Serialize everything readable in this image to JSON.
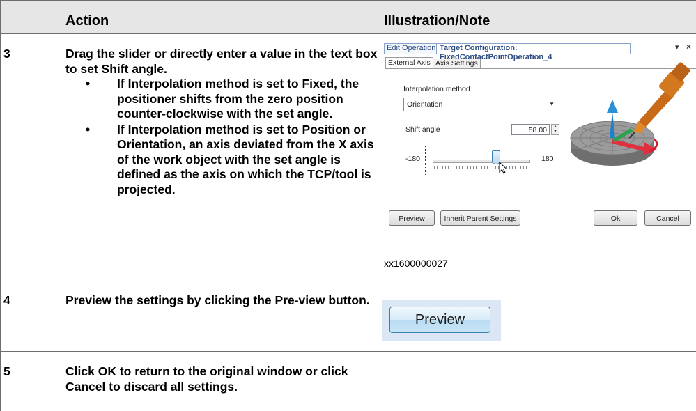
{
  "table": {
    "headers": {
      "step": "",
      "action": "Action",
      "note": "Illustration/Note"
    },
    "rows": [
      {
        "step": "3",
        "action": {
          "intro": [
            "Drag the slider or directly enter a value in the text box to set ",
            "Shift angle",
            "."
          ],
          "bullets": [
            [
              "If ",
              "Interpolation method",
              " is set to ",
              "Fixed",
              ", the positioner shifts from the zero position counter-clockwise with the set angle."
            ],
            [
              "If ",
              "Interpolation method",
              " is set to ",
              "Position",
              " or ",
              "Orientation",
              ", an axis deviated from the X axis of the work object with the set angle is defined as the axis on which the TCP/tool is projected."
            ]
          ]
        },
        "figure_caption": "xx1600000027"
      },
      {
        "step": "4",
        "action": [
          "Preview the settings by clicking the ",
          "Pre-view",
          " button."
        ]
      },
      {
        "step": "5",
        "action": [
          "Click ",
          "OK",
          " to return to the original window or click ",
          "Cancel",
          " to discard all settings."
        ]
      }
    ],
    "bullet_glyph": "•"
  },
  "dialog": {
    "tabs": [
      "Edit Operation",
      "Target Configuration: FixedContactPointOperation_4"
    ],
    "window_controls": {
      "pin": "▾",
      "close": "×"
    },
    "subtabs": [
      "External Axis",
      "Axis Settings"
    ],
    "interpolation_label": "Interpolation method",
    "interpolation_value": "Orientation",
    "shift_label": "Shift angle",
    "shift_value": "58.00",
    "slider_min": "-180",
    "slider_max": "180",
    "slider_value": 58,
    "buttons": {
      "preview": "Preview",
      "inherit": "Inherit Parent Settings",
      "ok": "Ok",
      "cancel": "Cancel"
    },
    "colors": {
      "tab_text": "#2d4d82",
      "tab_border": "#8aa4c9",
      "positioner": "#8a8a8a",
      "robot": "#d2781e",
      "axis_x": "#e03040",
      "axis_y": "#30a050",
      "axis_z": "#2080c8"
    },
    "icons": [
      "combo-dropdown-icon",
      "spinner-icon",
      "mouse-cursor-icon",
      "positioner-illustration"
    ]
  },
  "preview_image": {
    "label": "Preview",
    "background": "#dbe7f4"
  }
}
